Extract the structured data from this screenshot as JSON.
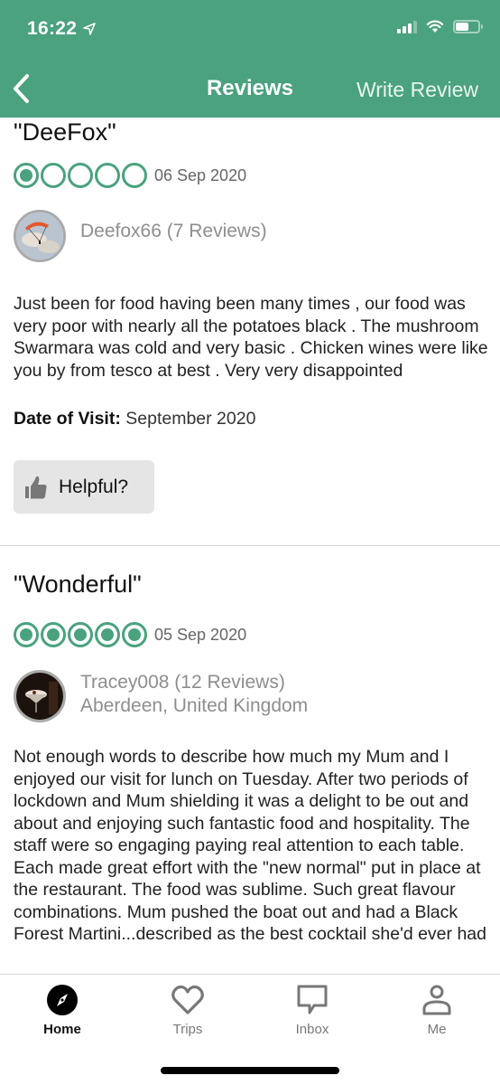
{
  "status_bar": {
    "time": "16:22",
    "location_icon": "location-arrow-icon",
    "signal_icon": "cellular-signal-icon",
    "wifi_icon": "wifi-icon",
    "battery_icon": "battery-icon"
  },
  "nav": {
    "back_icon": "chevron-left-icon",
    "title": "Reviews",
    "write_review": "Write Review"
  },
  "colors": {
    "brand_green": "#4aa27e",
    "helpful_bg": "#e5e5e5"
  },
  "reviews": [
    {
      "title": "\"DeeFox\"",
      "rating": 1,
      "rating_max": 5,
      "date": "06 Sep 2020",
      "user": "Deefox66 (7 Reviews)",
      "location": "",
      "body": "Just been for food having been many times , our food was very poor with nearly all the potatoes black . The mushroom Swarmara was cold and very basic . Chicken wines were like you by from tesco at best . Very very disappointed",
      "visit_label": "Date of Visit:",
      "visit_value": "September 2020",
      "helpful_label": "Helpful?"
    },
    {
      "title": "\"Wonderful\"",
      "rating": 5,
      "rating_max": 5,
      "date": "05 Sep 2020",
      "user": "Tracey008 (12 Reviews)",
      "location": "Aberdeen, United Kingdom",
      "body": "Not enough words to describe how much my Mum and I enjoyed our visit for lunch on Tuesday.  After two periods of lockdown and Mum shielding it was a delight to be out and about and enjoying such fantastic food and hospitality.  The staff were so engaging paying real attention to each table.  Each made great effort with the \"new normal\" put in place at the restaurant.  The food was sublime.  Such great flavour combinations.  Mum pushed the boat out and had a Black Forest Martini...described as the best cocktail she'd ever had"
    }
  ],
  "tabbar": {
    "items": [
      {
        "label": "Home",
        "icon": "compass-icon",
        "active": true
      },
      {
        "label": "Trips",
        "icon": "heart-icon",
        "active": false
      },
      {
        "label": "Inbox",
        "icon": "message-icon",
        "active": false
      },
      {
        "label": "Me",
        "icon": "person-icon",
        "active": false
      }
    ]
  }
}
